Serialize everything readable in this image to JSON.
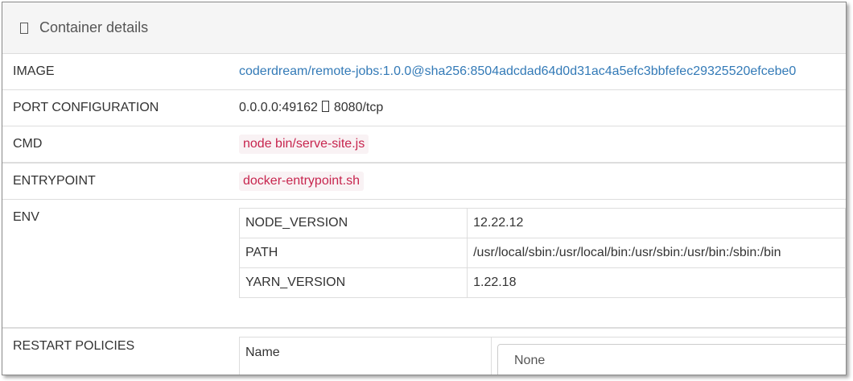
{
  "panel": {
    "title": "Container details",
    "icon": "server-icon"
  },
  "rows": {
    "image": {
      "label": "IMAGE",
      "value": "coderdream/remote-jobs:1.0.0@sha256:8504adcdad64d0d31ac4a5efc3bbfefec29325520efcebe0"
    },
    "port": {
      "label": "PORT CONFIGURATION",
      "host": "0.0.0.0:49162",
      "container": "8080/tcp"
    },
    "cmd": {
      "label": "CMD",
      "value": "node bin/serve-site.js"
    },
    "entrypoint": {
      "label": "ENTRYPOINT",
      "value": "docker-entrypoint.sh"
    },
    "env": {
      "label": "ENV",
      "items": [
        {
          "key": "NODE_VERSION",
          "value": "12.22.12"
        },
        {
          "key": "PATH",
          "value": "/usr/local/sbin:/usr/local/bin:/usr/sbin:/usr/bin:/sbin:/bin"
        },
        {
          "key": "YARN_VERSION",
          "value": "1.22.18"
        }
      ]
    },
    "restart": {
      "label": "RESTART POLICIES",
      "name_label": "Name",
      "selected": "None"
    }
  },
  "colors": {
    "link": "#337ab7",
    "code_text": "#c7254e",
    "code_bg": "#f9f2f4",
    "header_bg": "#f5f5f5"
  }
}
